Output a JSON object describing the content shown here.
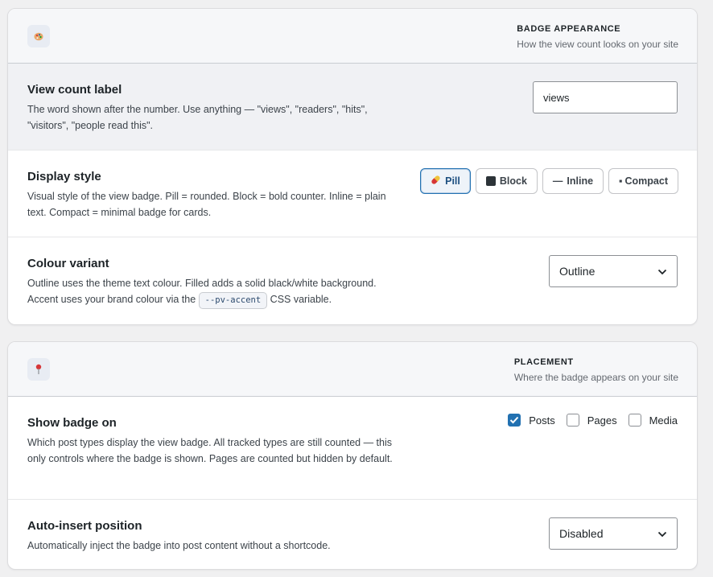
{
  "badge_appearance": {
    "icon": "palette-icon",
    "title": "BADGE APPEARANCE",
    "subtitle": "How the view count looks on your site",
    "view_count_label": {
      "title": "View count label",
      "description": "The word shown after the number. Use anything — \"views\", \"readers\", \"hits\", \"visitors\", \"people read this\".",
      "value": "views"
    },
    "display_style": {
      "title": "Display style",
      "description": "Visual style of the view badge. Pill = rounded. Block = bold counter. Inline = plain text. Compact = minimal badge for cards.",
      "options": [
        {
          "label": "Pill",
          "icon": "pill-icon",
          "selected": true
        },
        {
          "label": "Block",
          "icon": "square-icon",
          "selected": false
        },
        {
          "label": "Inline",
          "icon": "dash-icon",
          "selected": false
        },
        {
          "label": "Compact",
          "icon": "dot-icon",
          "selected": false
        }
      ]
    },
    "colour_variant": {
      "title": "Colour variant",
      "description_pre": "Outline uses the theme text colour. Filled adds a solid black/white background. Accent uses your brand colour via the",
      "code": "--pv-accent",
      "description_post": "CSS variable.",
      "selected": "Outline"
    }
  },
  "placement": {
    "icon": "pushpin-icon",
    "title": "PLACEMENT",
    "subtitle": "Where the badge appears on your site",
    "show_badge_on": {
      "title": "Show badge on",
      "description": "Which post types display the view badge. All tracked types are still counted — this only controls where the badge is shown. Pages are counted but hidden by default.",
      "options": [
        {
          "label": "Posts",
          "checked": true
        },
        {
          "label": "Pages",
          "checked": false
        },
        {
          "label": "Media",
          "checked": false
        }
      ]
    },
    "auto_insert": {
      "title": "Auto-insert position",
      "description": "Automatically inject the badge into post content without a shortcode.",
      "selected": "Disabled"
    }
  },
  "colors": {
    "accent": "#2271b1",
    "page_bg": "#f0f0f1",
    "header_bg": "#f6f7f9",
    "highlight_row_bg": "#f0f1f4"
  }
}
